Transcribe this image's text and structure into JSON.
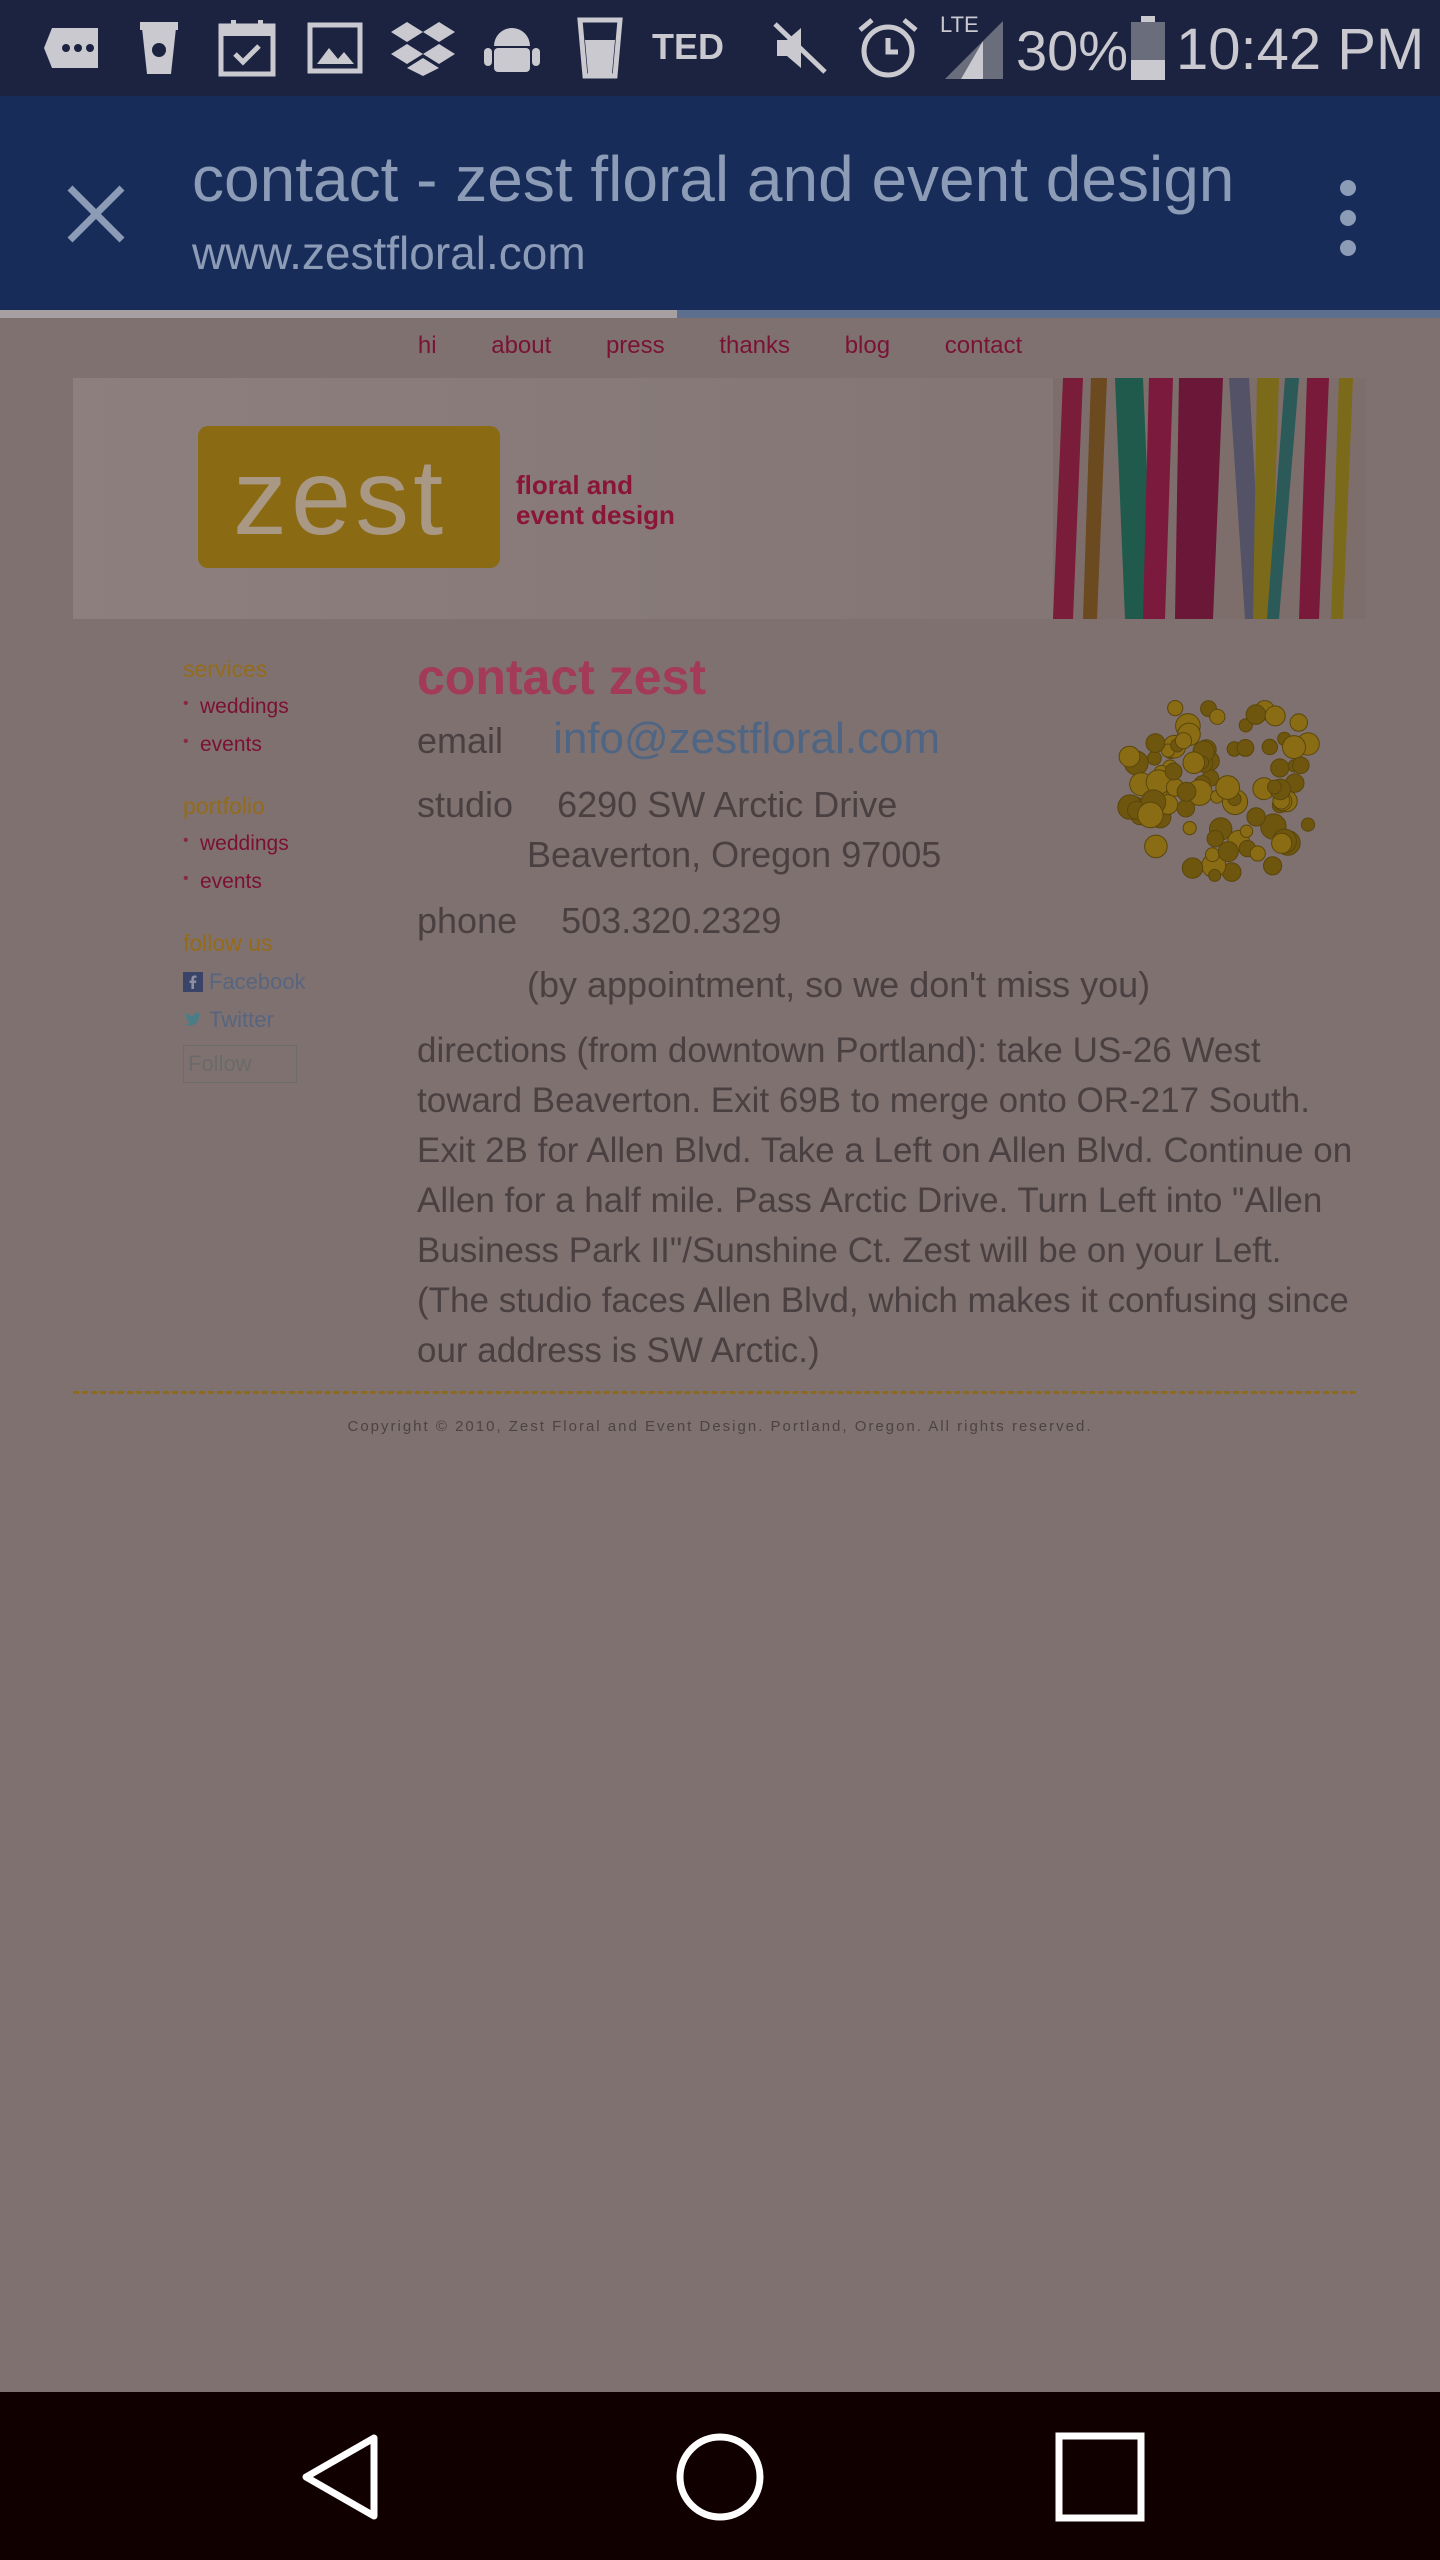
{
  "status_bar": {
    "icons": [
      "chat-icon",
      "coffee-icon",
      "calendar-icon",
      "gallery-icon",
      "dropbox-icon",
      "android-icon",
      "cup-icon",
      "ted-logo",
      "mute-icon",
      "alarm-icon",
      "lte-signal-icon",
      "battery-icon"
    ],
    "ted_label": "TED",
    "lte_label": "LTE",
    "battery": "30%",
    "time": "10:42 PM"
  },
  "browser": {
    "title": "contact - zest floral and event design",
    "url": "www.zestfloral.com",
    "load_progress": 0.47
  },
  "site": {
    "nav": [
      "hi",
      "about",
      "press",
      "thanks",
      "blog",
      "contact"
    ],
    "logo_word": "zest",
    "tagline_line1": "floral and",
    "tagline_line2": "event design",
    "sidebar": {
      "services_heading": "services",
      "services": [
        "weddings",
        "events"
      ],
      "portfolio_heading": "portfolio",
      "portfolio": [
        "weddings",
        "events"
      ],
      "follow_heading": "follow us",
      "facebook": "Facebook",
      "twitter": "Twitter",
      "follow_button": "Follow"
    },
    "contact": {
      "title": "contact zest",
      "email_label": "email",
      "email": "info@zestfloral.com",
      "studio_label": "studio",
      "address_line1": "6290 SW Arctic Drive",
      "address_line2": "Beaverton, Oregon 97005",
      "phone_label": "phone",
      "phone": "503.320.2329",
      "appointment_note": "(by appointment, so we don't miss you)",
      "directions": "directions (from downtown Portland): take US-26 West toward Beaverton. Exit 69B to merge onto OR-217 South. Exit 2B for Allen Blvd. Take a Left on Allen Blvd. Continue on Allen for a half mile. Pass Arctic Drive. Turn Left into \"Allen Business Park II\"/Sunshine Ct. Zest will be on your Left. (The studio faces Allen Blvd, which makes it confusing since our address is SW Arctic.)"
    },
    "copyright": "Copyright © 2010, Zest Floral and Event Design. Portland, Oregon. All rights reserved."
  },
  "nav_bar": {
    "buttons": [
      "back-button",
      "home-button",
      "recents-button"
    ]
  },
  "colors": {
    "status_bg": "#1b2340",
    "tabbar_bg": "#182c5a",
    "page_bg": "#7f7170",
    "accent_gold": "#8b6a14",
    "accent_magenta": "#a23a58"
  }
}
